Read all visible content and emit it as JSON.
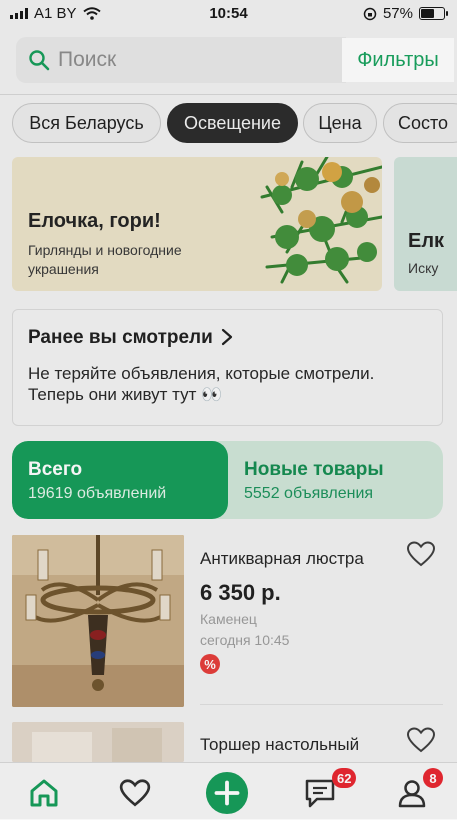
{
  "status_bar": {
    "carrier": "A1 BY",
    "time": "10:54",
    "battery": "57%"
  },
  "search": {
    "placeholder": "Поиск",
    "filters_label": "Фильтры"
  },
  "chips": [
    {
      "label": "Вся Беларусь",
      "active": false
    },
    {
      "label": "Освещение",
      "active": true
    },
    {
      "label": "Цена",
      "active": false
    },
    {
      "label": "Состо",
      "active": false
    }
  ],
  "banners": [
    {
      "title": "Елочка, гори!",
      "subtitle": "Гирлянды и новогодние украшения"
    },
    {
      "title": "Елк",
      "subtitle": "Иску"
    }
  ],
  "recent": {
    "title": "Ранее вы смотрели",
    "text": "Не теряйте объявления, которые смотрели. Теперь они живут тут 👀"
  },
  "tabs": [
    {
      "title": "Всего",
      "count": "19619 объявлений",
      "active": true
    },
    {
      "title": "Новые товары",
      "count": "5552 объявления",
      "active": false
    }
  ],
  "listings": [
    {
      "title": "Антикварная люстра",
      "price": "6 350 р.",
      "location": "Каменец",
      "time": "сегодня 10:45",
      "badge": "%"
    },
    {
      "title": "Торшер настольный",
      "price": "",
      "location": "",
      "time": "",
      "badge": ""
    }
  ],
  "bottom_nav": {
    "items": [
      "home-icon",
      "favorites-icon",
      "add-icon",
      "messages-icon",
      "profile-icon"
    ],
    "messages_badge": "62",
    "profile_badge": "8"
  },
  "colors": {
    "accent": "#109a55",
    "badge": "#e8212a",
    "active_chip": "#262626"
  }
}
